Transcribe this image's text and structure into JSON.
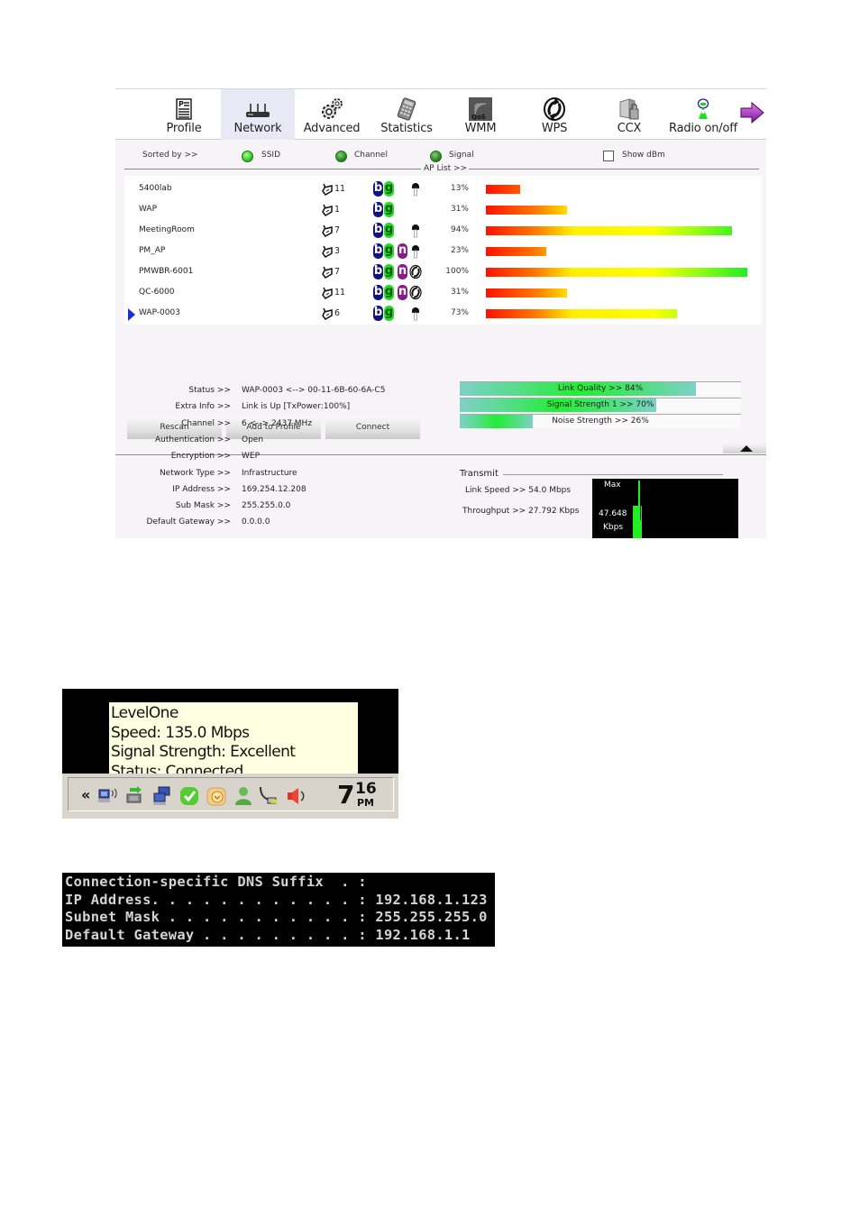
{
  "toolbar": {
    "items": [
      {
        "label": "Profile",
        "icon": "profile-icon",
        "active": false
      },
      {
        "label": "Network",
        "icon": "router-icon",
        "active": true
      },
      {
        "label": "Advanced",
        "icon": "gears-icon",
        "active": false
      },
      {
        "label": "Statistics",
        "icon": "calculator-icon",
        "active": false
      },
      {
        "label": "WMM",
        "icon": "qos-icon",
        "active": false
      },
      {
        "label": "WPS",
        "icon": "wps-icon",
        "active": false
      },
      {
        "label": "CCX",
        "icon": "ccx-icon",
        "active": false
      },
      {
        "label": "Radio on/off",
        "icon": "radio-antenna-icon",
        "active": false
      }
    ],
    "next_icon": "arrow-right-icon"
  },
  "sort": {
    "label": "Sorted by >>",
    "options": [
      {
        "label": "SSID",
        "selected": true
      },
      {
        "label": "Channel",
        "selected": false
      },
      {
        "label": "Signal",
        "selected": false
      }
    ],
    "show_dbm_label": "Show dBm",
    "show_dbm_checked": false
  },
  "ap_list": {
    "title": "AP List >>",
    "rows": [
      {
        "ssid": "5400lab",
        "channel": "11",
        "modes": [
          "b",
          "g"
        ],
        "security": "key",
        "signal_pct": 13,
        "signal_label": "13%",
        "selected": false
      },
      {
        "ssid": "WAP",
        "channel": "1",
        "modes": [
          "b",
          "g"
        ],
        "security": "none",
        "signal_pct": 31,
        "signal_label": "31%",
        "selected": false
      },
      {
        "ssid": "MeetingRoom",
        "channel": "7",
        "modes": [
          "b",
          "g"
        ],
        "security": "key",
        "signal_pct": 94,
        "signal_label": "94%",
        "selected": false
      },
      {
        "ssid": "PM_AP",
        "channel": "3",
        "modes": [
          "b",
          "g",
          "n"
        ],
        "security": "key",
        "signal_pct": 23,
        "signal_label": "23%",
        "selected": false
      },
      {
        "ssid": "PMWBR-6001",
        "channel": "7",
        "modes": [
          "b",
          "g",
          "n"
        ],
        "security": "wps",
        "signal_pct": 100,
        "signal_label": "100%",
        "selected": false
      },
      {
        "ssid": "QC-6000",
        "channel": "11",
        "modes": [
          "b",
          "g",
          "n"
        ],
        "security": "wps",
        "signal_pct": 31,
        "signal_label": "31%",
        "selected": false
      },
      {
        "ssid": "WAP-0003",
        "channel": "6",
        "modes": [
          "b",
          "g"
        ],
        "security": "key",
        "signal_pct": 73,
        "signal_label": "73%",
        "selected": true
      }
    ]
  },
  "buttons": {
    "rescan": "Rescan",
    "add_to_profile": "Add to Profile",
    "connect": "Connect"
  },
  "status": {
    "rows": [
      {
        "key": "Status >>",
        "value": "WAP-0003 <--> 00-11-6B-60-6A-C5"
      },
      {
        "key": "Extra Info >>",
        "value": "Link is Up [TxPower:100%]"
      },
      {
        "key": "Channel >>",
        "value": "6 <--> 2437 MHz"
      },
      {
        "key": "Authentication >>",
        "value": "Open"
      },
      {
        "key": "Encryption >>",
        "value": "WEP"
      },
      {
        "key": "Network Type >>",
        "value": "Infrastructure"
      },
      {
        "key": "IP Address >>",
        "value": "169.254.12.208"
      },
      {
        "key": "Sub Mask >>",
        "value": "255.255.0.0"
      },
      {
        "key": "Default Gateway >>",
        "value": "0.0.0.0"
      }
    ]
  },
  "meters": [
    {
      "label": "Link Quality >> 84%",
      "pct": 84
    },
    {
      "label": "Signal Strength 1 >> 70%",
      "pct": 70
    },
    {
      "label": "Noise Strength >> 26%",
      "pct": 26
    }
  ],
  "transmit": {
    "title": "Transmit",
    "link_speed": "Link Speed >>  54.0 Mbps",
    "throughput": "Throughput >> 27.792 Kbps",
    "graph_max_label": "Max",
    "graph_value": "47.648",
    "graph_unit": "Kbps"
  },
  "tray": {
    "tooltip_lines": [
      "LevelOne",
      "Speed: 135.0 Mbps",
      "Signal Strength: Excellent",
      "Status: Connected"
    ],
    "chevron": "«",
    "icons": [
      "wireless-network-icon",
      "network-transfer-icon",
      "network-computers-icon",
      "shield-check-icon",
      "clock-badge-icon",
      "user-icon",
      "usb-cable-icon",
      "speaker-icon"
    ],
    "clock_hour": "7",
    "clock_min": "16",
    "clock_ampm": "PM"
  },
  "console": {
    "lines": [
      "Connection-specific DNS Suffix  . :",
      "IP Address. . . . . . . . . . . . : 192.168.1.123",
      "Subnet Mask . . . . . . . . . . . : 255.255.255.0",
      "Default Gateway . . . . . . . . . : 192.168.1.1"
    ]
  }
}
